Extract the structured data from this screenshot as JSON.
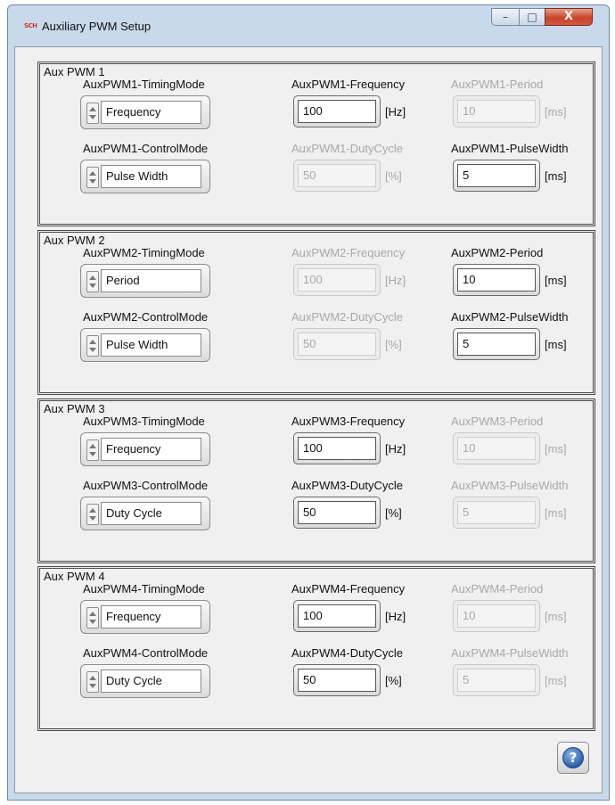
{
  "window": {
    "title": "Auxiliary PWM Setup",
    "app_icon_text": "SCH",
    "buttons": {
      "minimize": "–",
      "maximize": "□",
      "close": "X"
    }
  },
  "groups": [
    {
      "title": "Aux PWM 1",
      "timing_label": "AuxPWM1-TimingMode",
      "timing_value": "Frequency",
      "control_label": "AuxPWM1-ControlMode",
      "control_value": "Pulse Width",
      "frequency": {
        "label": "AuxPWM1-Frequency",
        "value": "100",
        "unit": "[Hz]",
        "enabled": true
      },
      "period": {
        "label": "AuxPWM1-Period",
        "value": "10",
        "unit": "[ms]",
        "enabled": false
      },
      "dutycycle": {
        "label": "AuxPWM1-DutyCycle",
        "value": "50",
        "unit": "[%]",
        "enabled": false
      },
      "pulsewidth": {
        "label": "AuxPWM1-PulseWidth",
        "value": "5",
        "unit": "[ms]",
        "enabled": true
      }
    },
    {
      "title": "Aux PWM 2",
      "timing_label": "AuxPWM2-TimingMode",
      "timing_value": "Period",
      "control_label": "AuxPWM2-ControlMode",
      "control_value": "Pulse Width",
      "frequency": {
        "label": "AuxPWM2-Frequency",
        "value": "100",
        "unit": "[Hz]",
        "enabled": false
      },
      "period": {
        "label": "AuxPWM2-Period",
        "value": "10",
        "unit": "[ms]",
        "enabled": true
      },
      "dutycycle": {
        "label": "AuxPWM2-DutyCycle",
        "value": "50",
        "unit": "[%]",
        "enabled": false
      },
      "pulsewidth": {
        "label": "AuxPWM2-PulseWidth",
        "value": "5",
        "unit": "[ms]",
        "enabled": true
      }
    },
    {
      "title": "Aux PWM 3",
      "timing_label": "AuxPWM3-TimingMode",
      "timing_value": "Frequency",
      "control_label": "AuxPWM3-ControlMode",
      "control_value": "Duty Cycle",
      "frequency": {
        "label": "AuxPWM3-Frequency",
        "value": "100",
        "unit": "[Hz]",
        "enabled": true
      },
      "period": {
        "label": "AuxPWM3-Period",
        "value": "10",
        "unit": "[ms]",
        "enabled": false
      },
      "dutycycle": {
        "label": "AuxPWM3-DutyCycle",
        "value": "50",
        "unit": "[%]",
        "enabled": true
      },
      "pulsewidth": {
        "label": "AuxPWM3-PulseWidth",
        "value": "5",
        "unit": "[ms]",
        "enabled": false
      }
    },
    {
      "title": "Aux PWM 4",
      "timing_label": "AuxPWM4-TimingMode",
      "timing_value": "Frequency",
      "control_label": "AuxPWM4-ControlMode",
      "control_value": "Duty Cycle",
      "frequency": {
        "label": "AuxPWM4-Frequency",
        "value": "100",
        "unit": "[Hz]",
        "enabled": true
      },
      "period": {
        "label": "AuxPWM4-Period",
        "value": "10",
        "unit": "[ms]",
        "enabled": false
      },
      "dutycycle": {
        "label": "AuxPWM4-DutyCycle",
        "value": "50",
        "unit": "[%]",
        "enabled": true
      },
      "pulsewidth": {
        "label": "AuxPWM4-PulseWidth",
        "value": "5",
        "unit": "[ms]",
        "enabled": false
      }
    }
  ],
  "help_button": {
    "glyph": "?"
  }
}
